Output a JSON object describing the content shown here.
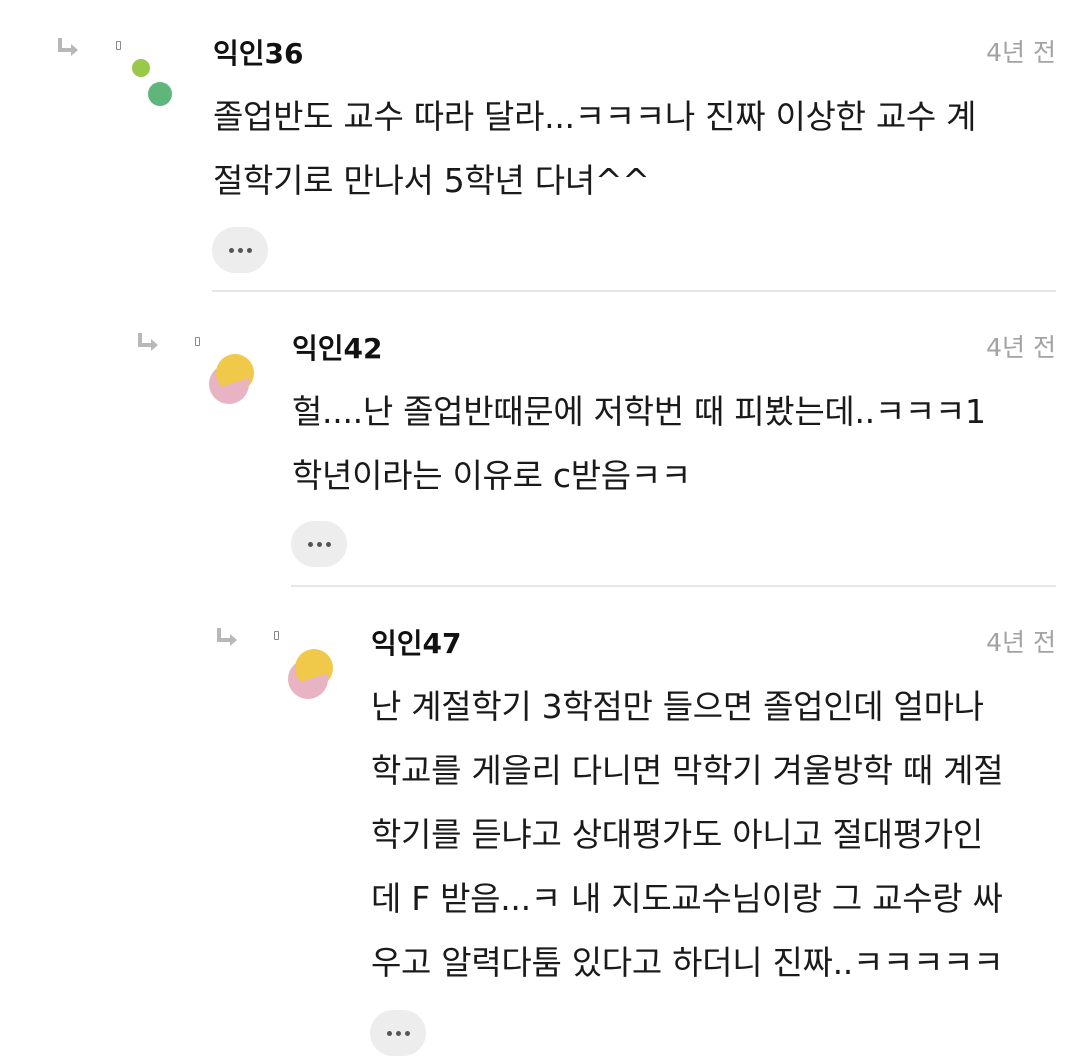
{
  "comments": [
    {
      "nickname": "익인36",
      "time": "4년 전",
      "lines": [
        "졸업반도 교수 따라 달라...ㅋㅋㅋ나 진짜 이상한 교수 계",
        "절학기로 만나서 5학년 다녀^^"
      ],
      "avatar_colors": [
        "#9ac94a",
        "#5fb67a"
      ]
    },
    {
      "nickname": "익인42",
      "time": "4년 전",
      "lines": [
        "헐....난 졸업반때문에 저학번 때 피봤는데..ㅋㅋㅋ1",
        "학년이라는 이유로 c받음ㅋㅋ"
      ],
      "avatar_colors": [
        "#f0c84a",
        "#e8b3c3"
      ]
    },
    {
      "nickname": "익인47",
      "time": "4년 전",
      "lines": [
        "난 계절학기 3학점만 들으면 졸업인데 얼마나",
        "학교를 게을리 다니면 막학기 겨울방학 때 계절",
        "학기를 듣냐고 상대평가도 아니고 절대평가인",
        "데 F 받음...ㅋ 내 지도교수님이랑 그 교수랑 싸",
        "우고 알력다툼 있다고 하더니 진짜..ㅋㅋㅋㅋㅋ"
      ],
      "avatar_colors": [
        "#f0c84a",
        "#e8b3c3"
      ]
    }
  ],
  "icons": {
    "reply": "reply-arrow-icon",
    "more": "more-dots-icon"
  },
  "colors": {
    "time_text": "#a3a3a3",
    "more_button_bg": "#ededed",
    "divider": "#e6e6e6"
  }
}
